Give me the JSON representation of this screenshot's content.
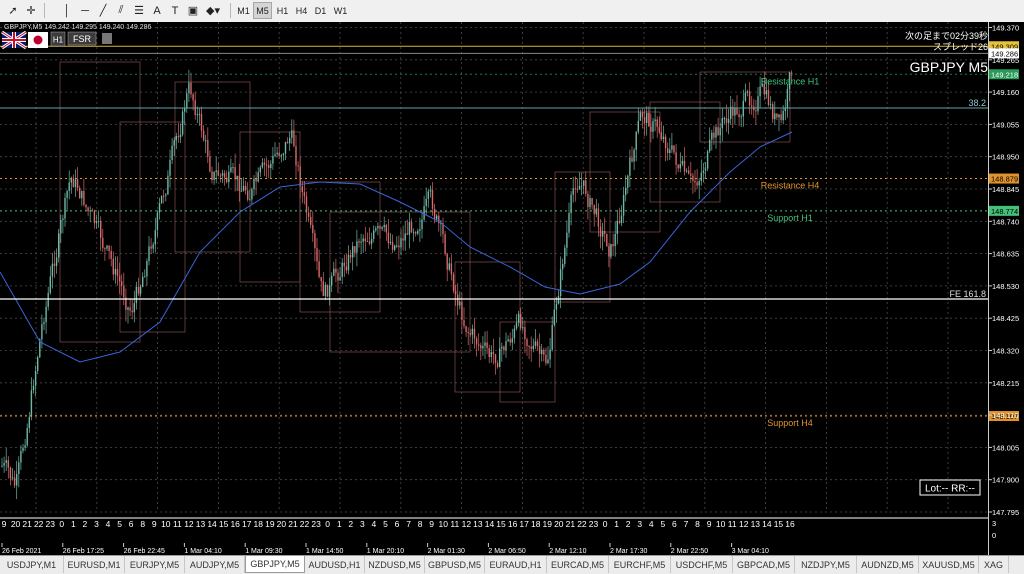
{
  "toolbar": {
    "icons": [
      "cursor-icon",
      "crosshair-icon",
      "vertical-line-icon",
      "horizontal-line-icon",
      "trendline-icon",
      "channel-icon",
      "fibonacci-icon",
      "text-icon",
      "text-label-icon",
      "shapes-icon"
    ],
    "timeframes": [
      "M1",
      "M5",
      "H1",
      "H4",
      "D1",
      "W1"
    ],
    "active_timeframe": "M5"
  },
  "chart": {
    "info_line": "GBPJPY,M5  149.242 149.295 149.240 149.286",
    "fsr_label": "FSR",
    "countdown": "次の足まで02分39秒",
    "spread": "スプレッド26",
    "symbol_label": "GBPJPY M5",
    "lot_rr": "Lot:-- RR:--",
    "price_axis": [
      "149.370",
      "149.265",
      "149.160",
      "149.055",
      "148.950",
      "148.845",
      "148.740",
      "148.635",
      "148.530",
      "148.425",
      "148.320",
      "148.215",
      "148.110",
      "148.005",
      "147.900",
      "147.795"
    ],
    "price_badges": {
      "ask": "149.309",
      "bid": "149.286",
      "res_h1": "149.218",
      "res_h4": "148.879",
      "sup_h1": "148.774",
      "sup_h4": "148.107"
    },
    "level_labels": {
      "res_h1": "Resistance H1",
      "res_h4": "Resistance H4",
      "sup_h1": "Support H1",
      "sup_h4": "Support H4",
      "fib_38": "38.2",
      "fe_161": "FE 161.8"
    },
    "hour_labels": [
      "9",
      "20",
      "21",
      "22",
      "23",
      "0",
      "1",
      "2",
      "3",
      "4",
      "5",
      "6",
      "8",
      "9",
      "10",
      "11",
      "12",
      "13",
      "14",
      "15",
      "16",
      "17",
      "18",
      "19",
      "20",
      "21",
      "22",
      "23",
      "0",
      "1",
      "2",
      "3",
      "4",
      "5",
      "6",
      "7",
      "8",
      "9",
      "10",
      "11",
      "12",
      "13",
      "14",
      "15",
      "16",
      "17",
      "18",
      "19",
      "20",
      "21",
      "22",
      "23",
      "0",
      "1",
      "2",
      "3",
      "4",
      "5",
      "6",
      "7",
      "8",
      "9",
      "10",
      "11",
      "12",
      "13",
      "14",
      "15",
      "16"
    ],
    "time_axis": [
      "26 Feb 2021",
      "26 Feb 17:25",
      "26 Feb 22:45",
      "1 Mar 04:10",
      "1 Mar 09:30",
      "1 Mar 14:50",
      "1 Mar 20:10",
      "2 Mar 01:30",
      "2 Mar 06:50",
      "2 Mar 12:10",
      "2 Mar 17:30",
      "2 Mar 22:50",
      "3 Mar 04:10"
    ],
    "sub_axis": [
      "3",
      "0"
    ],
    "colors": {
      "bull": "#6fb8a8",
      "bear": "#d96a6a",
      "resistance": "#e0932c",
      "support_h1": "#45c07a",
      "ma": "#3a64d8"
    }
  },
  "tabs": [
    "USDJPY,M1",
    "EURUSD,M1",
    "EURJPY,M5",
    "AUDJPY,M5",
    "GBPJPY,M5",
    "AUDUSD,H1",
    "NZDUSD,M5",
    "GBPUSD,M5",
    "EURAUD,H1",
    "EURCAD,M5",
    "EURCHF,M5",
    "USDCHF,M5",
    "GBPCAD,M5",
    "NZDJPY,M5",
    "AUDNZD,M5",
    "XAUUSD,M5",
    "XAG"
  ],
  "active_tab": "GBPJPY,M5"
}
